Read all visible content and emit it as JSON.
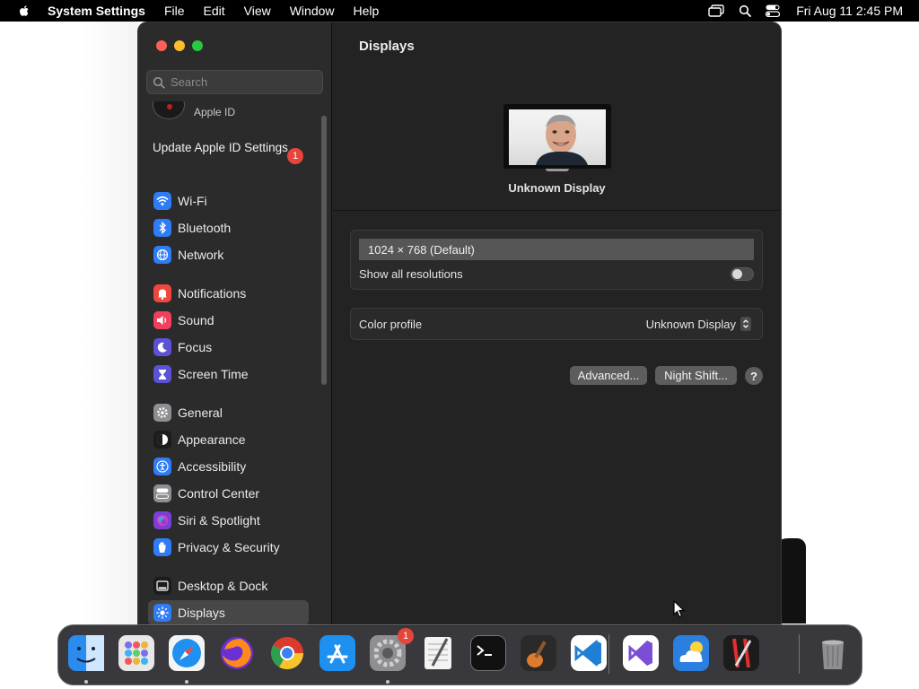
{
  "menubar": {
    "app_name": "System Settings",
    "menus": [
      "File",
      "Edit",
      "View",
      "Window",
      "Help"
    ],
    "clock": "Fri Aug 11  2:45 PM"
  },
  "sidebar": {
    "search_placeholder": "Search",
    "apple_id_label": "Apple ID",
    "update_label": "Update Apple ID Settings",
    "update_badge": "1",
    "groups": [
      [
        {
          "label": "Wi-Fi",
          "icon": "wifi-icon",
          "color": "#2e7cf6"
        },
        {
          "label": "Bluetooth",
          "icon": "bluetooth-icon",
          "color": "#2e7cf6"
        },
        {
          "label": "Network",
          "icon": "globe-icon",
          "color": "#2e7cf6"
        }
      ],
      [
        {
          "label": "Notifications",
          "icon": "bell-icon",
          "color": "#f0463e"
        },
        {
          "label": "Sound",
          "icon": "speaker-icon",
          "color": "#f0405c"
        },
        {
          "label": "Focus",
          "icon": "moon-icon",
          "color": "#5b52d6"
        },
        {
          "label": "Screen Time",
          "icon": "hourglass-icon",
          "color": "#5b52d6"
        }
      ],
      [
        {
          "label": "General",
          "icon": "gear-icon",
          "color": "#8e8e93"
        },
        {
          "label": "Appearance",
          "icon": "appearance-icon",
          "color": "#1c1c1e"
        },
        {
          "label": "Accessibility",
          "icon": "accessibility-icon",
          "color": "#2e7cf6"
        },
        {
          "label": "Control Center",
          "icon": "toggles-icon",
          "color": "#8e8e93"
        },
        {
          "label": "Siri & Spotlight",
          "icon": "siri-icon",
          "color": "#7a3fd8"
        },
        {
          "label": "Privacy & Security",
          "icon": "hand-icon",
          "color": "#2e7cf6"
        }
      ],
      [
        {
          "label": "Desktop & Dock",
          "icon": "dock-icon",
          "color": "#1c1c1e"
        },
        {
          "label": "Displays",
          "icon": "sun-icon",
          "color": "#2e7cf6",
          "selected": true
        }
      ]
    ]
  },
  "main": {
    "title": "Displays",
    "display_name": "Unknown Display",
    "resolution": "1024 × 768 (Default)",
    "show_all_label": "Show all resolutions",
    "color_profile_label": "Color profile",
    "color_profile_value": "Unknown Display",
    "advanced_label": "Advanced...",
    "night_shift_label": "Night Shift...",
    "help_label": "?"
  },
  "dock": {
    "items": [
      {
        "name": "finder-icon",
        "color": "#2b8cf0",
        "running": true
      },
      {
        "name": "launchpad-icon",
        "color": "#e8e8e8",
        "running": false
      },
      {
        "name": "safari-icon",
        "color": "#f4f4f4",
        "running": true
      },
      {
        "name": "firefox-icon",
        "color": "#6b2fd6",
        "running": false
      },
      {
        "name": "chrome-icon",
        "color": "#ffffff",
        "running": false
      },
      {
        "name": "app-store-icon",
        "color": "#1e90f0",
        "running": false
      },
      {
        "name": "system-settings-icon",
        "color": "#8e8e93",
        "running": true,
        "badge": "1"
      },
      {
        "name": "textedit-icon",
        "color": "#f3f3f3",
        "running": false
      },
      {
        "name": "terminal-icon",
        "color": "#111111",
        "running": false
      },
      {
        "name": "garageband-icon",
        "color": "#2a2a2a",
        "running": false
      },
      {
        "name": "vscode-icon",
        "color": "#ffffff",
        "running": false
      },
      {
        "name": "visual-studio-icon",
        "color": "#ffffff",
        "running": false
      },
      {
        "name": "weather-icon",
        "color": "#2a7fe0",
        "running": false
      },
      {
        "name": "script-editor-icon",
        "color": "#1c1c1c",
        "running": false
      },
      {
        "name": "trash-icon",
        "color": "#3a3a3a",
        "running": false
      }
    ]
  }
}
